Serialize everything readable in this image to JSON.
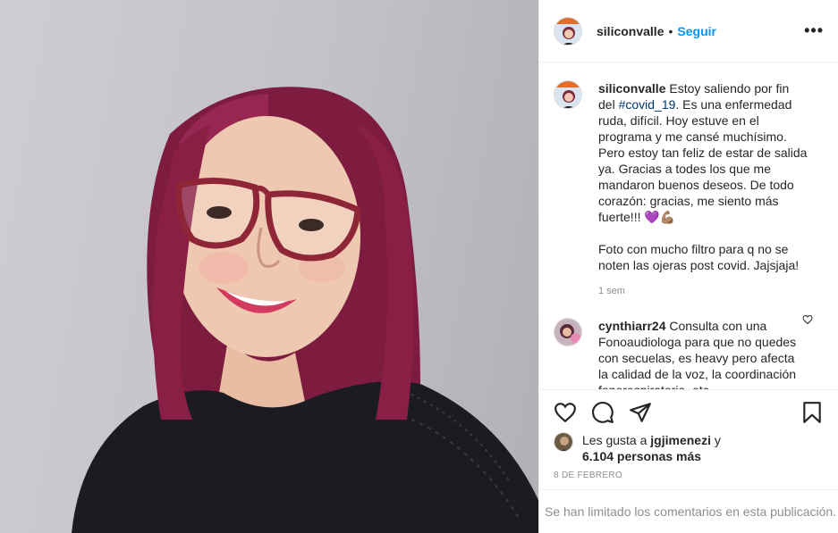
{
  "header": {
    "username": "siliconvalle",
    "separator": "•",
    "follow_label": "Seguir",
    "more_label": "•••"
  },
  "caption": {
    "username": "siliconvalle",
    "text_before": " Estoy saliendo por fin del ",
    "hashtag": "#covid_19",
    "text_after": ". Es una enfermedad ruda, difícil. Hoy estuve en el programa y me cansé muchísimo. Pero estoy tan feliz de estar de salida ya. Gracias a todes los que me mandaron buenos deseos. De todo corazón: gracias, me siento más fuerte!!! 💜💪🏽\n\nFoto con mucho filtro para q no se noten las ojeras post covid. Jajsjaja!",
    "timestamp": "1 sem"
  },
  "comment": {
    "username": "cynthiarr24",
    "text": " Consulta con una Fonoaudiologa para que no quedes con secuelas, es heavy pero afecta la calidad de la voz, la coordinación fonorespiratoria, etc"
  },
  "likes": {
    "prefix": "Les gusta a ",
    "user": "jgjimenezi",
    "middle": " y",
    "count": "6.104 personas más"
  },
  "date": "8 DE FEBRERO",
  "comments_limited": "Se han limitado los comentarios en esta publicación.",
  "colors": {
    "follow": "#0095f6",
    "hashtag": "#00376b",
    "muted": "#8e8e8e",
    "hair": "#8a1f45",
    "glasses": "#8e2638",
    "top": "#1b1b22"
  },
  "icons": [
    "like-icon",
    "comment-icon",
    "share-icon",
    "save-icon",
    "more-options-icon",
    "comment-like-icon"
  ]
}
